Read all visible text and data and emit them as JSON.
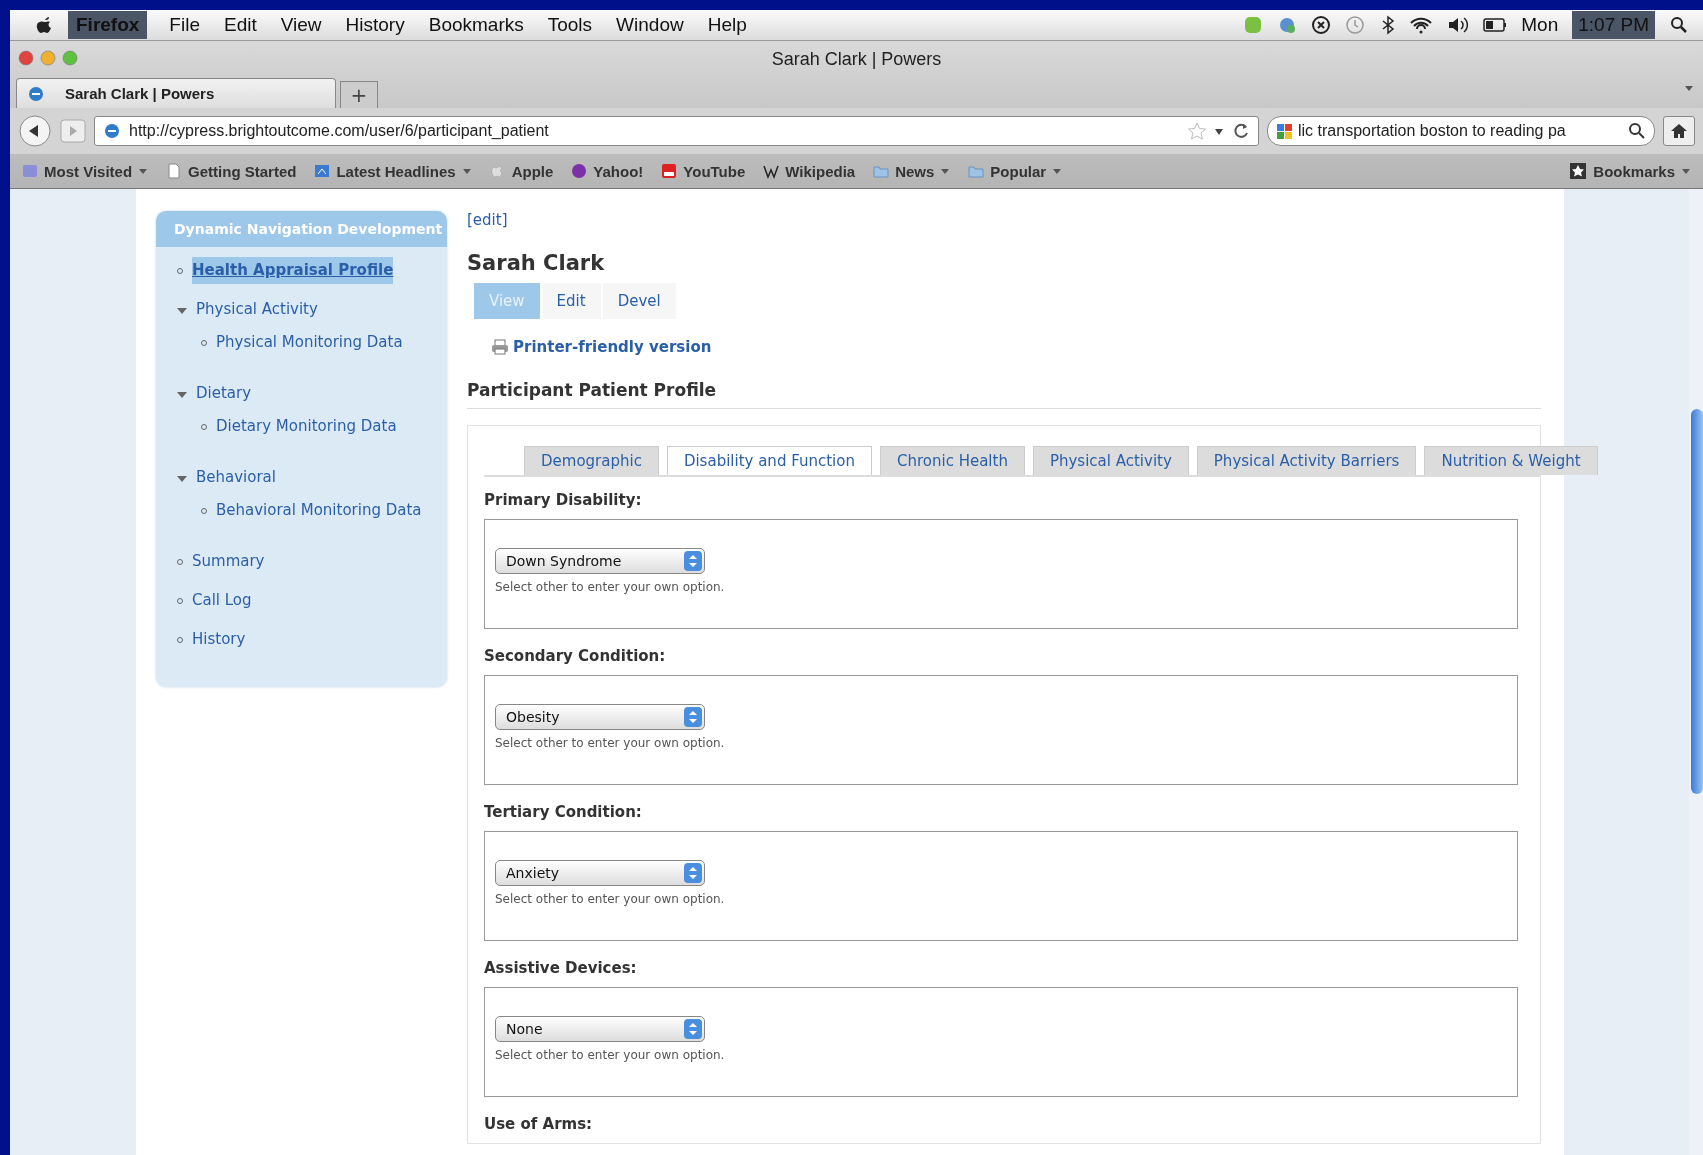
{
  "menubar": {
    "app": "Firefox",
    "menus": [
      "File",
      "Edit",
      "View",
      "History",
      "Bookmarks",
      "Tools",
      "Window",
      "Help"
    ],
    "day": "Mon",
    "time": "1:07 PM"
  },
  "window": {
    "title": "Sarah Clark | Powers"
  },
  "tabs": [
    {
      "label": "Sarah Clark | Powers",
      "selected": true
    }
  ],
  "new_tab": "+",
  "address_bar": {
    "value": "http://cypress.brightoutcome.com/user/6/participant_patient"
  },
  "search_field": {
    "value": "lic transportation boston to reading pa"
  },
  "bookmarks": [
    {
      "label": "Most Visited",
      "kind": "smart",
      "dropdown": true
    },
    {
      "label": "Getting Started",
      "kind": "page",
      "dropdown": false
    },
    {
      "label": "Latest Headlines",
      "kind": "feed",
      "dropdown": true
    },
    {
      "label": "Apple",
      "kind": "apple",
      "dropdown": false
    },
    {
      "label": "Yahoo!",
      "kind": "yahoo",
      "dropdown": false
    },
    {
      "label": "YouTube",
      "kind": "youtube",
      "dropdown": false
    },
    {
      "label": "Wikipedia",
      "kind": "wiki",
      "dropdown": false
    },
    {
      "label": "News",
      "kind": "folder",
      "dropdown": true
    },
    {
      "label": "Popular",
      "kind": "folder",
      "dropdown": true
    }
  ],
  "bookmarks_menu": "Bookmarks",
  "sidebar": {
    "title": "Dynamic Navigation Development",
    "items": [
      {
        "label": "Health Appraisal Profile",
        "selected": true
      },
      {
        "label": "Physical Activity",
        "selected": false,
        "children": [
          {
            "label": "Physical Monitoring Data",
            "selected": false
          }
        ]
      },
      {
        "label": "Dietary",
        "selected": false,
        "children": [
          {
            "label": "Dietary Monitoring Data",
            "selected": false
          }
        ]
      },
      {
        "label": "Behavioral",
        "selected": false,
        "children": [
          {
            "label": "Behavioral Monitoring Data",
            "selected": false
          }
        ]
      },
      {
        "label": "Summary",
        "selected": false
      },
      {
        "label": "Call Log",
        "selected": false
      },
      {
        "label": "History",
        "selected": false
      }
    ]
  },
  "main": {
    "edit_link": "[edit]",
    "title": "Sarah Clark",
    "local_tabs": [
      {
        "label": "View",
        "selected": true
      },
      {
        "label": "Edit",
        "selected": false
      },
      {
        "label": "Devel",
        "selected": false
      }
    ],
    "printer_link": "Printer-friendly version",
    "section_title": "Participant Patient Profile",
    "form_tabs": [
      {
        "label": "Demographic",
        "selected": false
      },
      {
        "label": "Disability and Function",
        "selected": true
      },
      {
        "label": "Chronic Health",
        "selected": false
      },
      {
        "label": "Physical Activity",
        "selected": false
      },
      {
        "label": "Physical Activity Barriers",
        "selected": false
      },
      {
        "label": "Nutrition & Weight",
        "selected": false
      }
    ],
    "fields": [
      {
        "label": "Primary Disability:",
        "value": "Down Syndrome",
        "hint": "Select other to enter your own option."
      },
      {
        "label": "Secondary Condition:",
        "value": "Obesity",
        "hint": "Select other to enter your own option."
      },
      {
        "label": "Tertiary Condition:",
        "value": "Anxiety",
        "hint": "Select other to enter your own option."
      },
      {
        "label": "Assistive Devices:",
        "value": "None",
        "hint": "Select other to enter your own option."
      },
      {
        "label": "Use of Arms:"
      }
    ]
  }
}
